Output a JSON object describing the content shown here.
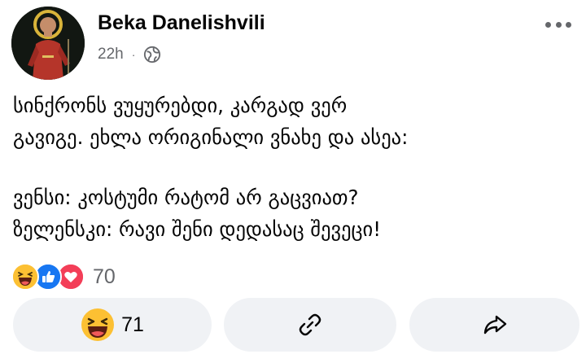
{
  "post": {
    "author": "Beka Danelishvili",
    "time": "22h",
    "separator": "·",
    "privacy_icon": "globe-icon",
    "more_icon": "more-horizontal-icon",
    "text_lines": [
      "სინქრონს ვუყურებდი, კარგად ვერ",
      "გავიგე. ეხლა ორიგინალი ვნახე და ასეა:",
      "",
      "ვენსი: კოსტუმი რატომ არ გაცვიათ?",
      "ზელენსკი: რავი შენი დედასაც შევეცი!"
    ]
  },
  "reactions": {
    "icons": [
      "haha-icon",
      "like-icon",
      "love-icon"
    ],
    "count": "70"
  },
  "actions": {
    "react": {
      "icon": "haha-icon",
      "count": "71"
    },
    "link": {
      "icon": "link-icon"
    },
    "share": {
      "icon": "share-arrow-icon"
    }
  },
  "colors": {
    "secondary_text": "#65676b",
    "button_bg": "#f0f2f5",
    "like_blue": "#1877f2",
    "love_red": "#f33e58",
    "haha_yellow": "#fcc033"
  }
}
